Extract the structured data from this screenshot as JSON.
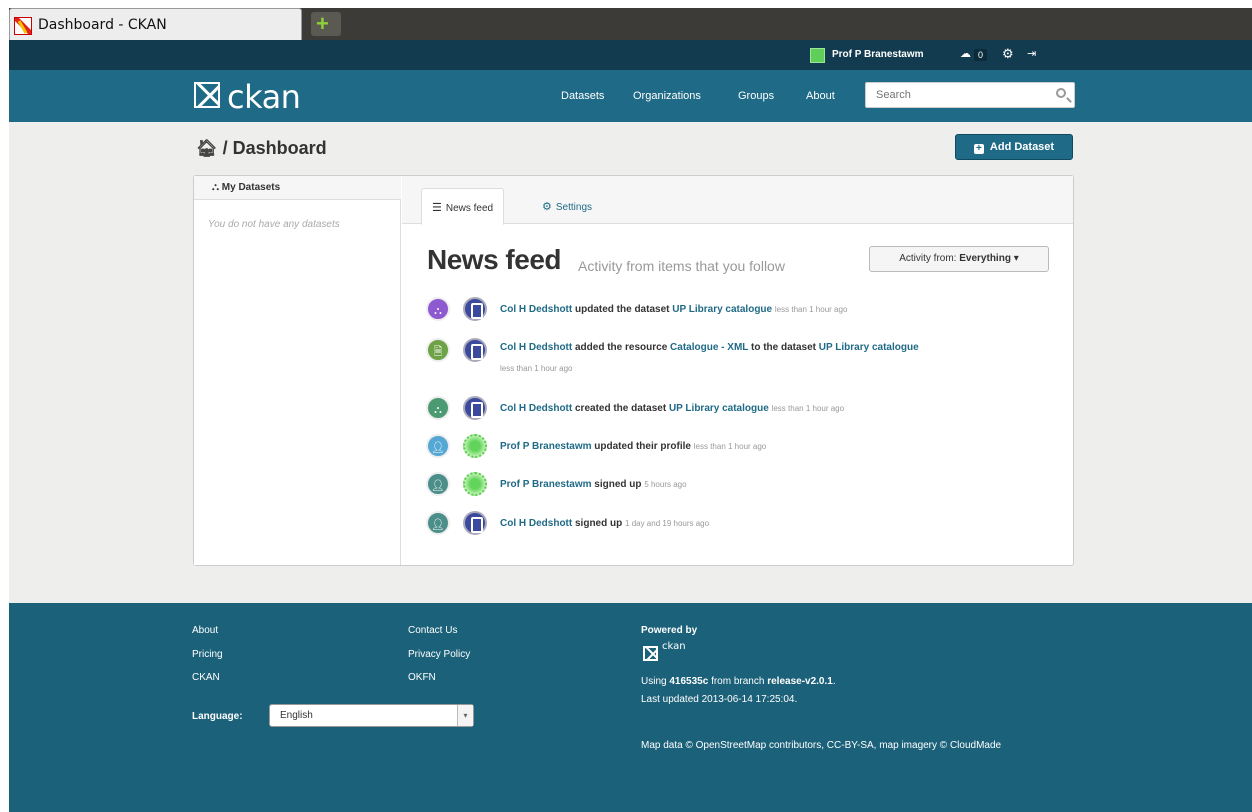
{
  "browser": {
    "tab_title": "Dashboard - CKAN",
    "new_tab_symbol": "+"
  },
  "account": {
    "user_name": "Prof P Branestawm",
    "dashboard_count": "0"
  },
  "masthead": {
    "logo_text": "ckan",
    "nav": [
      "Datasets",
      "Organizations",
      "Groups",
      "About"
    ],
    "search_placeholder": "Search"
  },
  "page": {
    "breadcrumb_sep": " / ",
    "breadcrumb_current": "Dashboard",
    "add_dataset_label": "Add Dataset"
  },
  "sidebar": {
    "title": "My Datasets",
    "empty_text": "You do not have any datasets"
  },
  "tabs": {
    "news_feed": "News feed",
    "settings": "Settings"
  },
  "feed": {
    "title": "News feed",
    "subtitle": "Activity from items that you follow",
    "activity_filter_prefix": "Activity from:",
    "activity_filter_value": "Everything"
  },
  "activities": [
    {
      "type_color": "#8e5ad0",
      "actor": "Col H Dedshott",
      "action": "updated the dataset",
      "object": "UP Library catalogue",
      "time": "less than 1 hour ago"
    },
    {
      "type_color": "#6da246",
      "actor": "Col H Dedshott",
      "action": "added the resource",
      "object": "Catalogue - XML",
      "action2": "to the dataset",
      "object2": "UP Library catalogue",
      "time": "less than 1 hour ago"
    },
    {
      "type_color": "#4c9a72",
      "actor": "Col H Dedshott",
      "action": "created the dataset",
      "object": "UP Library catalogue",
      "time": "less than 1 hour ago"
    },
    {
      "type_color": "#55a8d4",
      "actor": "Prof P Branestawm",
      "action": "updated their profile",
      "time": "less than 1 hour ago"
    },
    {
      "type_color": "#4c8f8a",
      "actor": "Prof P Branestawm",
      "action": "signed up",
      "time": "5 hours ago"
    },
    {
      "type_color": "#4c8f8a",
      "actor": "Col H Dedshott",
      "action": "signed up",
      "time": "1 day and 19 hours ago"
    }
  ],
  "footer": {
    "col1": [
      "About",
      "Pricing",
      "CKAN"
    ],
    "col2": [
      "Contact Us",
      "Privacy Policy",
      "OKFN"
    ],
    "language_label": "Language:",
    "language_value": "English",
    "powered_by": "Powered by",
    "logo_text": "ckan",
    "using_prefix": "Using",
    "commit": "416535c",
    "branch_prefix": "from branch",
    "branch": "release-v2.0.1",
    "branch_suffix": ".",
    "last_updated": "Last updated 2013-06-14 17:25:04.",
    "map_data": "Map data © OpenStreetMap contributors, CC-BY-SA, map imagery © CloudMade"
  }
}
